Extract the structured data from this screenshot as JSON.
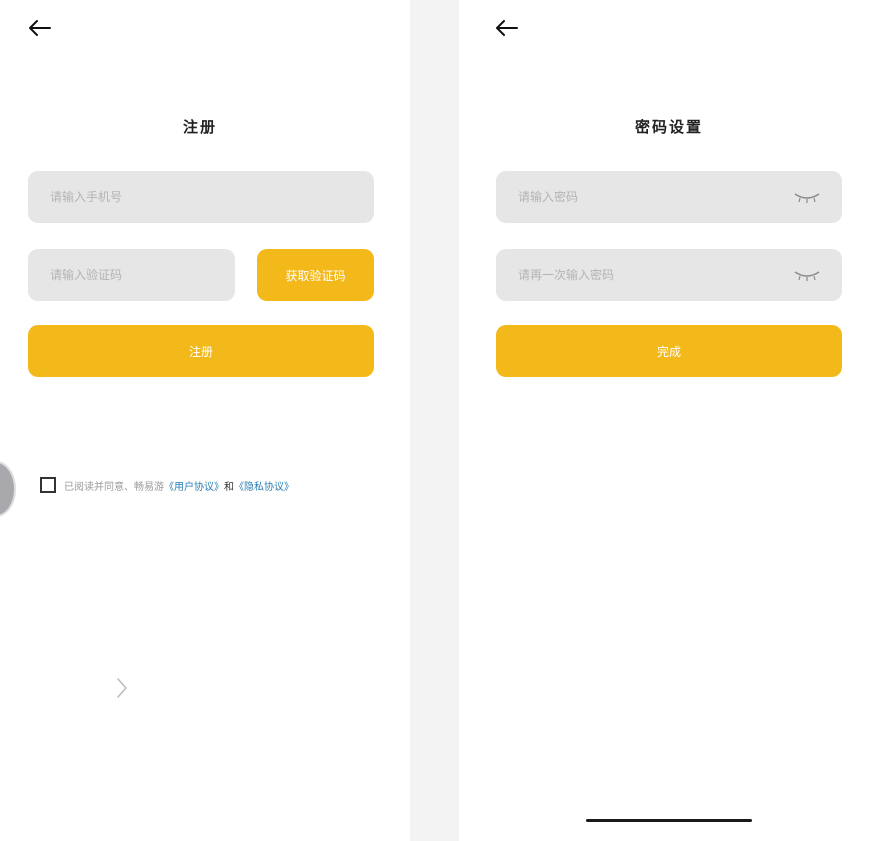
{
  "register": {
    "title": "注册",
    "phone_placeholder": "请输入手机号",
    "code_placeholder": "请输入验证码",
    "get_code_label": "获取验证码",
    "submit_label": "注册",
    "agreement": {
      "prefix": "已阅读并同意、畅易游",
      "user_agreement": "《用户协议》",
      "and": "和",
      "privacy_policy": "《隐私协议》"
    }
  },
  "password": {
    "title": "密码设置",
    "password_placeholder": "请输入密码",
    "confirm_placeholder": "请再一次输入密码",
    "done_label": "完成"
  },
  "colors": {
    "accent": "#f3b91b",
    "link": "#2a7fb5",
    "field_bg": "#e6e6e6",
    "gap_bg": "#f3f3f3"
  },
  "icons": {
    "back": "arrow-left-icon",
    "eye": "eye-closed-icon",
    "chevron": "chevron-right-icon"
  }
}
